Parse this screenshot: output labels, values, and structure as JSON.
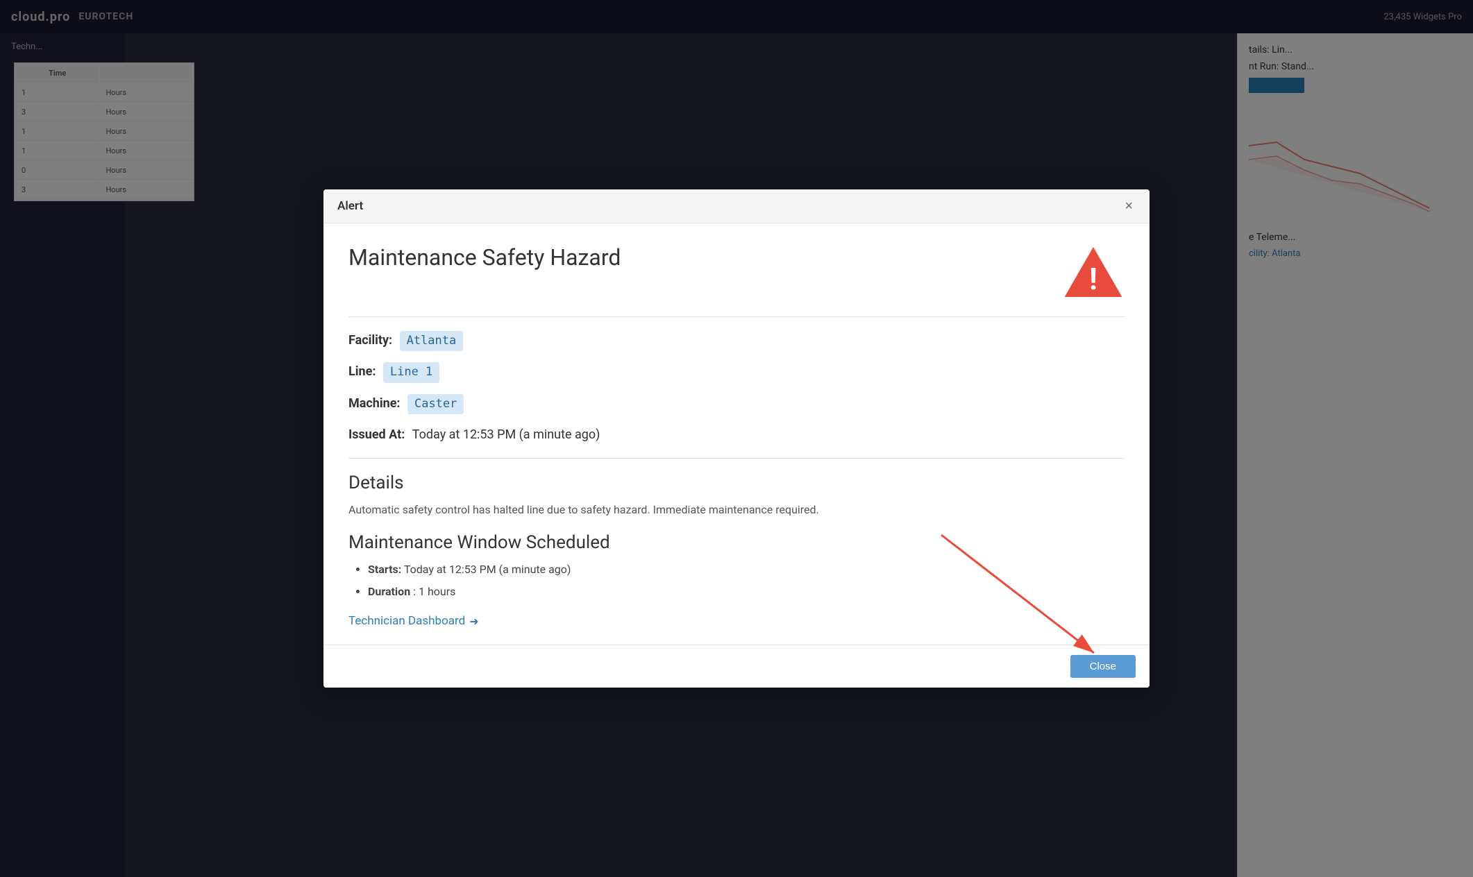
{
  "app": {
    "title": "Technician Dashboard",
    "logo": "cloud.pro",
    "logo2": "EUROTECH",
    "topbar_info": "23,435 Widgets Pro"
  },
  "modal": {
    "header_title": "Alert",
    "close_x_label": "×",
    "alert_title": "Maintenance Safety Hazard",
    "facility_label": "Facility:",
    "facility_value": "Atlanta",
    "line_label": "Line:",
    "line_value": "Line 1",
    "machine_label": "Machine:",
    "machine_value": "Caster",
    "issued_at_label": "Issued At:",
    "issued_at_value": "Today at 12:53 PM (a minute ago)",
    "details_title": "Details",
    "details_text": "Automatic safety control has halted line due to safety hazard. Immediate maintenance required.",
    "maintenance_title": "Maintenance Window Scheduled",
    "starts_label": "Starts:",
    "starts_value": "Today at 12:53 PM (a minute ago)",
    "duration_label": "Duration",
    "duration_value": "1 hours",
    "dashboard_link_text": "Technician Dashboard",
    "close_button_label": "Close"
  },
  "background": {
    "sidebar_item": "Techn...",
    "right_panel_title": "tails: Lin...",
    "right_panel_run": "nt Run: Stand...",
    "right_panel_facility": "cility: Atlanta",
    "right_panel_telemetry": "e Teleme...",
    "table_col1": "Time",
    "table_rows": [
      {
        "col1": "1",
        "col2": "Hours"
      },
      {
        "col1": "3",
        "col2": "Hours"
      },
      {
        "col1": "1",
        "col2": "Hours"
      },
      {
        "col1": "1",
        "col2": "Hours"
      },
      {
        "col1": "0",
        "col2": "Hours"
      },
      {
        "col1": "3",
        "col2": "Hours"
      }
    ]
  },
  "icons": {
    "warning": "⚠",
    "arrow_right": "➔",
    "close": "×"
  },
  "colors": {
    "warning_red": "#e74c3c",
    "badge_bg": "#d6e8f5",
    "badge_text": "#2a6496",
    "link_blue": "#2980b9",
    "close_btn": "#5b9bd5",
    "modal_bg": "#ffffff",
    "overlay": "rgba(0,0,0,0.5)"
  }
}
